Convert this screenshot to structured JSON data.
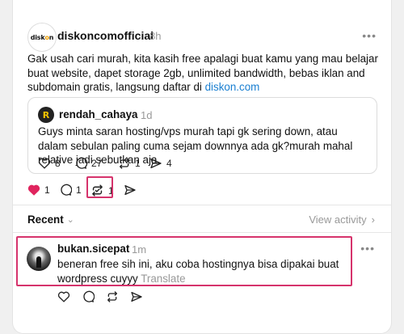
{
  "post": {
    "username": "diskoncomofficial",
    "time": "8h",
    "avatar_logo": "diskon",
    "text": "Gak usah cari murah, kita kasih free apalagi buat kamu yang mau belajar buat website, dapet storage 2gb, unlimited bandwidth, bebas iklan and subdomain gratis, langsung daftar di ",
    "link_text": "diskon.com",
    "more_label": "•••",
    "stats": {
      "likes": "1",
      "replies": "1",
      "reposts": "1"
    },
    "quoted": {
      "avatar_letter": "R",
      "username": "rendah_cahaya",
      "time": "1d",
      "text": "Guys minta saran hosting/vps murah tapi gk sering down, atau dalam sebulan paling cuma sejam downnya ada gk?murah mahal relative jadi sebutkan aja",
      "stats": {
        "likes": "8",
        "replies": "27",
        "reposts": "1",
        "shares": "4"
      }
    }
  },
  "activity": {
    "recent_label": "Recent",
    "view_activity_label": "View activity"
  },
  "comment": {
    "username": "bukan.sicepat",
    "time": "1m",
    "text": "beneran free sih ini, aku coba hostingnya bisa dipakai buat wordpress cuyyy",
    "translate_label": "Translate",
    "more_label": "•••"
  },
  "colors": {
    "highlight": "#d6336c",
    "like": "#e0245e",
    "link": "#1a7fd1"
  }
}
